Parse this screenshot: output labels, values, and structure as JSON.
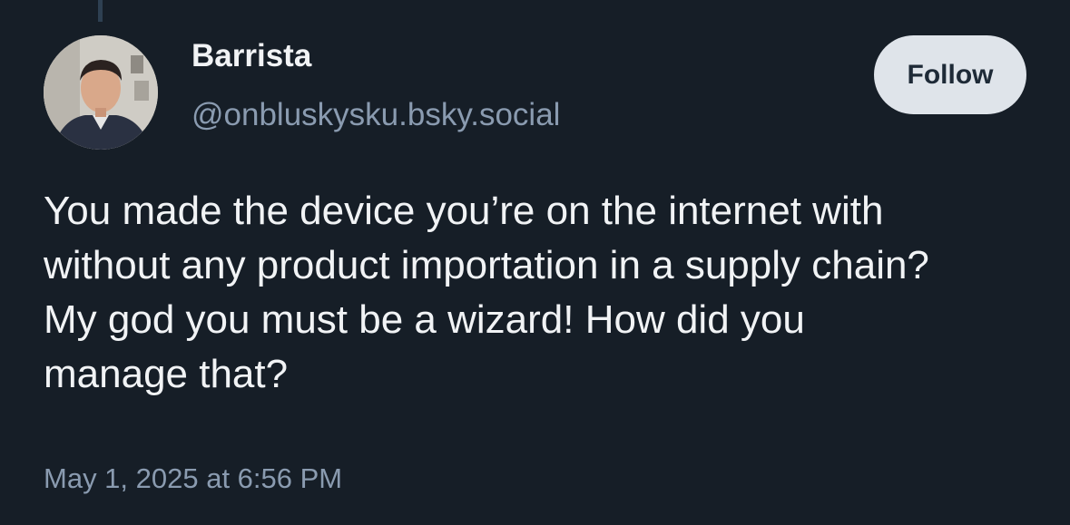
{
  "author": {
    "display_name": "Barrista",
    "handle": "@onbluskysku.bsky.social"
  },
  "follow_button": {
    "label": "Follow"
  },
  "post": {
    "text": "You made the device you’re on the internet with\nwithout any product importation in a supply chain?\nMy god you must be a wizard! How did you\nmanage that?",
    "timestamp": "May 1, 2025 at 6:56 PM"
  },
  "colors": {
    "background": "#161e27",
    "text_primary": "#f1f3f5",
    "text_secondary": "#8a9bb0",
    "button_bg": "#dfe4ea",
    "thread_line": "#2e4052"
  }
}
